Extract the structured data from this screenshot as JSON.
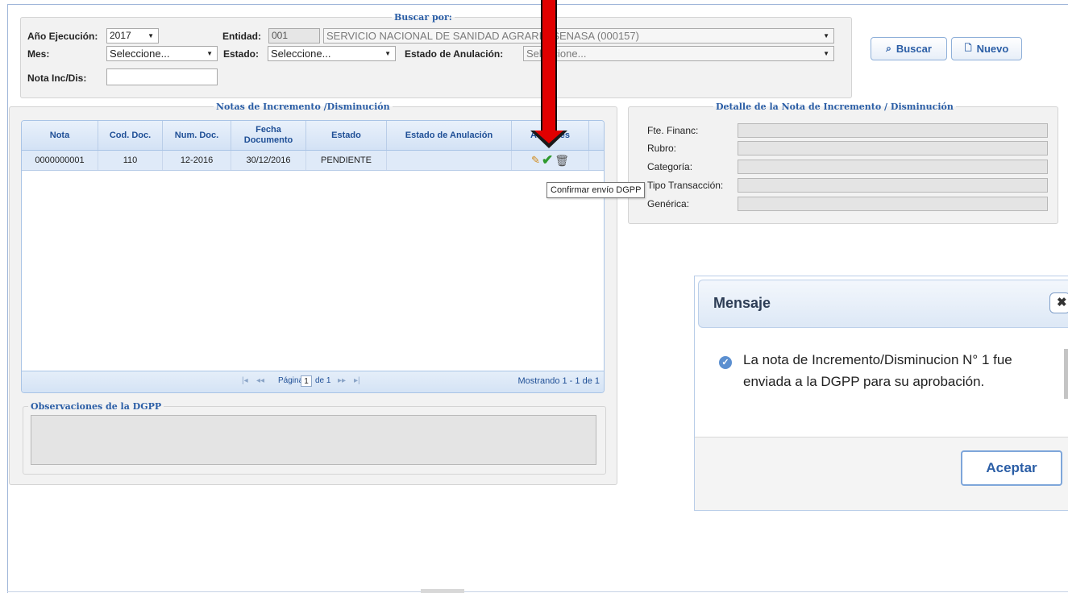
{
  "search": {
    "legend": "Buscar por:",
    "anio_label": "Año Ejecución:",
    "anio_value": "2017",
    "entidad_label": "Entidad:",
    "entidad_code": "001",
    "entidad_name": "SERVICIO NACIONAL DE SANIDAD AGRARIA-SENASA (000157)",
    "mes_label": "Mes:",
    "mes_value": "Seleccione...",
    "estado_label": "Estado:",
    "estado_value": "Seleccione...",
    "anulacion_label": "Estado de Anulación:",
    "anulacion_value": "Seleccione...",
    "nota_label": "Nota Inc/Dis:",
    "nota_value": "",
    "buscar_label": "Buscar",
    "nuevo_label": "Nuevo"
  },
  "notas": {
    "legend": "Notas de Incremento /Disminución",
    "columns": [
      "Nota",
      "Cod. Doc.",
      "Num. Doc.",
      "Fecha Documento",
      "Estado",
      "Estado de Anulación",
      "Acciones"
    ],
    "rows": [
      {
        "nota": "0000000001",
        "cod_doc": "110",
        "num_doc": "12-2016",
        "fecha": "30/12/2016",
        "estado": "PENDIENTE",
        "anulacion": ""
      }
    ],
    "pager": {
      "pagina_label": "Página",
      "page": "1",
      "de_label": "de 1",
      "mostrando": "Mostrando 1 - 1 de 1"
    }
  },
  "observaciones": {
    "legend": "Observaciones de la DGPP"
  },
  "detalle": {
    "legend": "Detalle de la Nota de Incremento / Disminución",
    "fields": [
      "Fte. Financ:",
      "Rubro:",
      "Categoría:",
      "Tipo Transacción:",
      "Genérica:"
    ]
  },
  "tooltip": "Confirmar envío DGPP",
  "dialog": {
    "title": "Mensaje",
    "message": "La nota de Incremento/Disminucion N° 1 fue enviada a la DGPP para su aprobación.",
    "accept_label": "Aceptar"
  },
  "colors": {
    "arrow": "#e00000",
    "accent": "#2b5ea6"
  }
}
